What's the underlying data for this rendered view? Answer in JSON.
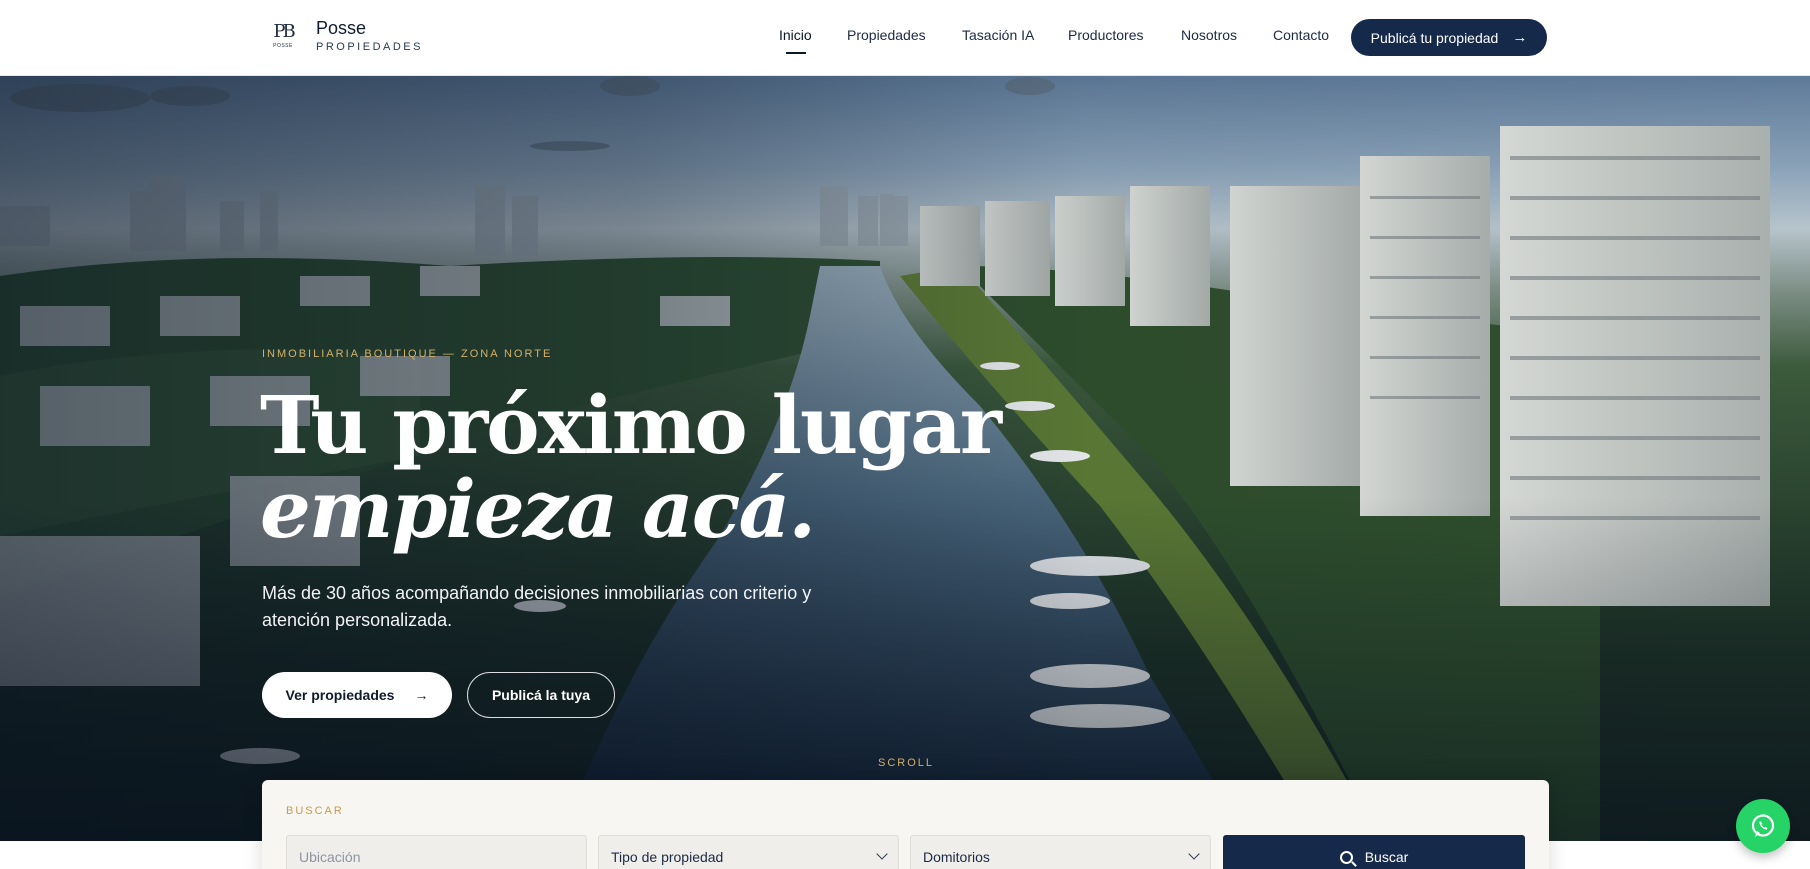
{
  "brand": {
    "mark_text": "PB",
    "mark_small": "POSSE",
    "name": "Posse",
    "subtitle": "PROPIEDADES"
  },
  "nav": {
    "items": [
      {
        "label": "Inicio",
        "active": true
      },
      {
        "label": "Propiedades"
      },
      {
        "label": "Tasación IA"
      },
      {
        "label": "Productores"
      },
      {
        "label": "Nosotros"
      },
      {
        "label": "Contacto"
      }
    ],
    "cta_label": "Publicá tu propiedad"
  },
  "hero": {
    "eyebrow": "INMOBILIARIA BOUTIQUE — ZONA NORTE",
    "title_line1": "Tu próximo lugar",
    "title_line2": "empieza acá.",
    "lede": "Más de 30 años acompañando decisiones inmobiliarias con criterio y atención personalizada.",
    "primary_button": "Ver propiedades",
    "secondary_button": "Publicá la tuya",
    "scroll_label": "SCROLL"
  },
  "search": {
    "label": "BUSCAR",
    "location_placeholder": "Ubicación",
    "type_select": "Tipo de propiedad",
    "bedrooms_select": "Domitorios",
    "button": "Buscar"
  },
  "colors": {
    "navy": "#152a4a",
    "gold": "#d6b067",
    "whatsapp": "#25d366"
  },
  "icons": {
    "cta_arrow": "arrow-right-icon",
    "search": "search-icon",
    "chevron": "chevron-down-icon",
    "whatsapp": "whatsapp-icon"
  }
}
